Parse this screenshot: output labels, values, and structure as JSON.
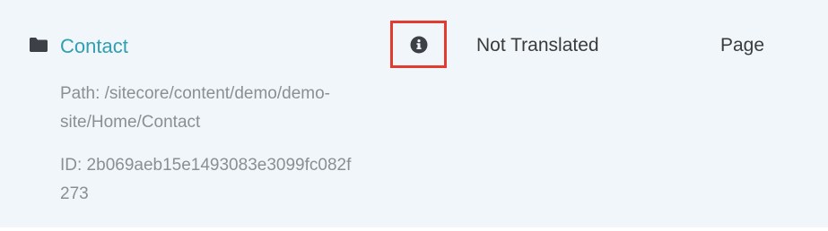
{
  "item": {
    "icon": "folder-icon",
    "title": "Contact",
    "path_line1": "Path: /sitecore/content/demo/demo-",
    "path_line2": "site/Home/Contact",
    "id_line1": "ID: 2b069aeb15e1493083e3099fc082f",
    "id_line2": "273",
    "info_icon": "info-icon",
    "status": "Not Translated",
    "type": "Page"
  },
  "colors": {
    "link": "#2f9fb1",
    "meta_text": "#8a8f94",
    "highlight_border": "#e23b30",
    "background": "#f0f6fa"
  }
}
